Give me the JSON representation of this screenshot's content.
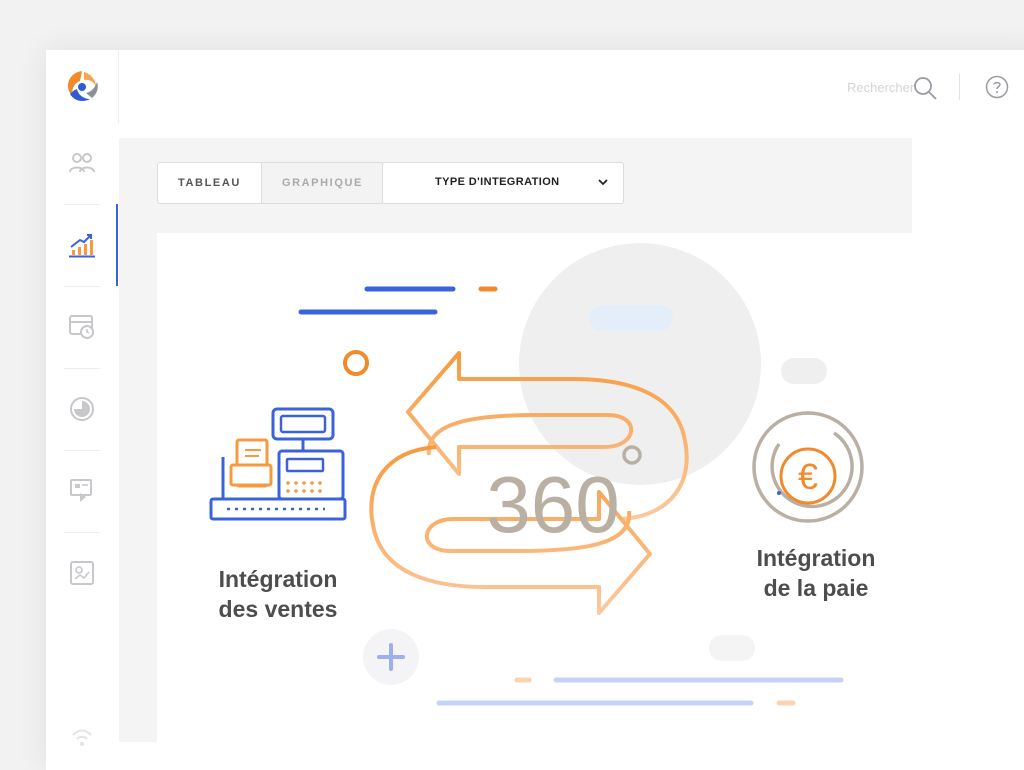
{
  "topbar": {
    "search_placeholder": "Rechercher"
  },
  "toolbar": {
    "tabs": [
      {
        "label": "TABLEAU",
        "active": true
      },
      {
        "label": "GRAPHIQUE",
        "active": false
      }
    ],
    "dropdown": {
      "label": "TYPE D'INTEGRATION"
    }
  },
  "sidebar": {
    "items": [
      {
        "icon": "users-icon",
        "active": false
      },
      {
        "icon": "growth-chart-icon",
        "active": true
      },
      {
        "icon": "calendar-clock-icon",
        "active": false
      },
      {
        "icon": "pie-chart-icon",
        "active": false
      },
      {
        "icon": "presentation-icon",
        "active": false
      },
      {
        "icon": "report-icon",
        "active": false
      }
    ]
  },
  "illustration": {
    "center_text": "360",
    "left_label_1": "Intégration",
    "left_label_2": "des ventes",
    "right_label_1": "Intégration",
    "right_label_2": "de la paie",
    "coin_symbol": "€"
  },
  "colors": {
    "accent_blue": "#3a63db",
    "accent_orange": "#f79a3e",
    "text_gray": "#4d4d4d",
    "numeral_gray": "#b9b0a3"
  }
}
